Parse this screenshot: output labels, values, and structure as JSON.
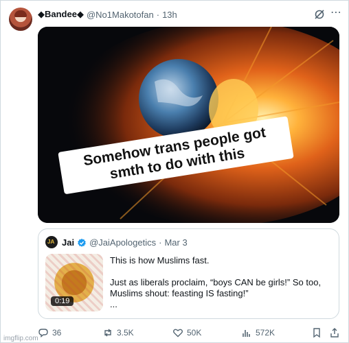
{
  "post": {
    "display_name": "◆Bandee◆",
    "handle": "@No1Makotofan",
    "separator": "·",
    "time": "13h"
  },
  "media": {
    "caption_line1": "Somehow trans people got",
    "caption_line2": "smth to do with this"
  },
  "quote": {
    "display_name": "Jai",
    "handle": "@JaiApologetics",
    "separator": "·",
    "date": "Mar 3",
    "video_duration": "0:19",
    "text_line1": "This is how Muslims fast.",
    "text_line2": "Just as liberals proclaim, “boys CAN be girls!” So too, Muslims shout: feasting IS fasting!”",
    "text_more": "..."
  },
  "actions": {
    "replies": "36",
    "reposts": "3.5K",
    "likes": "50K",
    "views": "572K"
  },
  "watermark": "imgflip.com",
  "colors": {
    "verified": "#1d9bf0",
    "secondary_text": "#536471",
    "border": "#cfd9de"
  },
  "icons": [
    "grok-icon",
    "more-icon",
    "verified-icon",
    "reply-icon",
    "repost-icon",
    "like-icon",
    "views-icon",
    "bookmark-icon",
    "share-icon"
  ]
}
